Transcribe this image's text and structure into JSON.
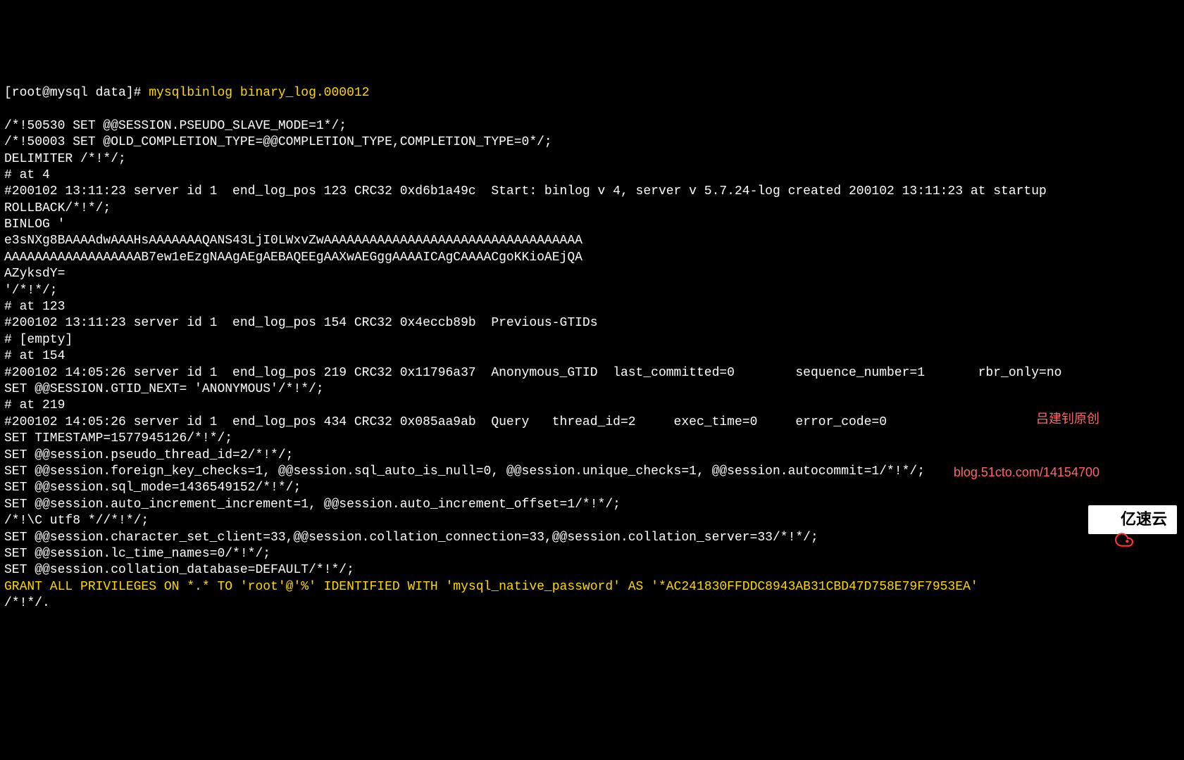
{
  "prompt": {
    "prefix": "[root@mysql data]# ",
    "command": "mysqlbinlog binary_log.000012"
  },
  "lines": [
    "/*!50530 SET @@SESSION.PSEUDO_SLAVE_MODE=1*/;",
    "/*!50003 SET @OLD_COMPLETION_TYPE=@@COMPLETION_TYPE,COMPLETION_TYPE=0*/;",
    "DELIMITER /*!*/;",
    "# at 4",
    "#200102 13:11:23 server id 1  end_log_pos 123 CRC32 0xd6b1a49c  Start: binlog v 4, server v 5.7.24-log created 200102 13:11:23 at startup",
    "ROLLBACK/*!*/;",
    "BINLOG '",
    "e3sNXg8BAAAAdwAAAHsAAAAAAAQANS43LjI0LWxvZwAAAAAAAAAAAAAAAAAAAAAAAAAAAAAAAAAA",
    "AAAAAAAAAAAAAAAAAAB7ew1eEzgNAAgAEgAEBAQEEgAAXwAEGggAAAAICAgCAAAACgoKKioAEjQA",
    "AZyksdY=",
    "'/*!*/;",
    "# at 123",
    "#200102 13:11:23 server id 1  end_log_pos 154 CRC32 0x4eccb89b  Previous-GTIDs",
    "# [empty]",
    "# at 154",
    "#200102 14:05:26 server id 1  end_log_pos 219 CRC32 0x11796a37  Anonymous_GTID  last_committed=0        sequence_number=1       rbr_only=no",
    "SET @@SESSION.GTID_NEXT= 'ANONYMOUS'/*!*/;",
    "# at 219",
    "#200102 14:05:26 server id 1  end_log_pos 434 CRC32 0x085aa9ab  Query   thread_id=2     exec_time=0     error_code=0",
    "SET TIMESTAMP=1577945126/*!*/;",
    "SET @@session.pseudo_thread_id=2/*!*/;",
    "SET @@session.foreign_key_checks=1, @@session.sql_auto_is_null=0, @@session.unique_checks=1, @@session.autocommit=1/*!*/;",
    "SET @@session.sql_mode=1436549152/*!*/;",
    "SET @@session.auto_increment_increment=1, @@session.auto_increment_offset=1/*!*/;",
    "/*!\\C utf8 *//*!*/;",
    "SET @@session.character_set_client=33,@@session.collation_connection=33,@@session.collation_server=33/*!*/;",
    "SET @@session.lc_time_names=0/*!*/;",
    "SET @@session.collation_database=DEFAULT/*!*/;"
  ],
  "grant_line": "GRANT ALL PRIVILEGES ON *.* TO 'root'@'%' IDENTIFIED WITH 'mysql_native_password' AS '*AC241830FFDDC8943AB31CBD47D758E79F7953EA'",
  "last_partial": "/*!*/.",
  "watermark": {
    "line1": "吕建钊原创",
    "line2": "blog.51cto.com/14154700"
  },
  "logo": {
    "text": "亿速云"
  }
}
